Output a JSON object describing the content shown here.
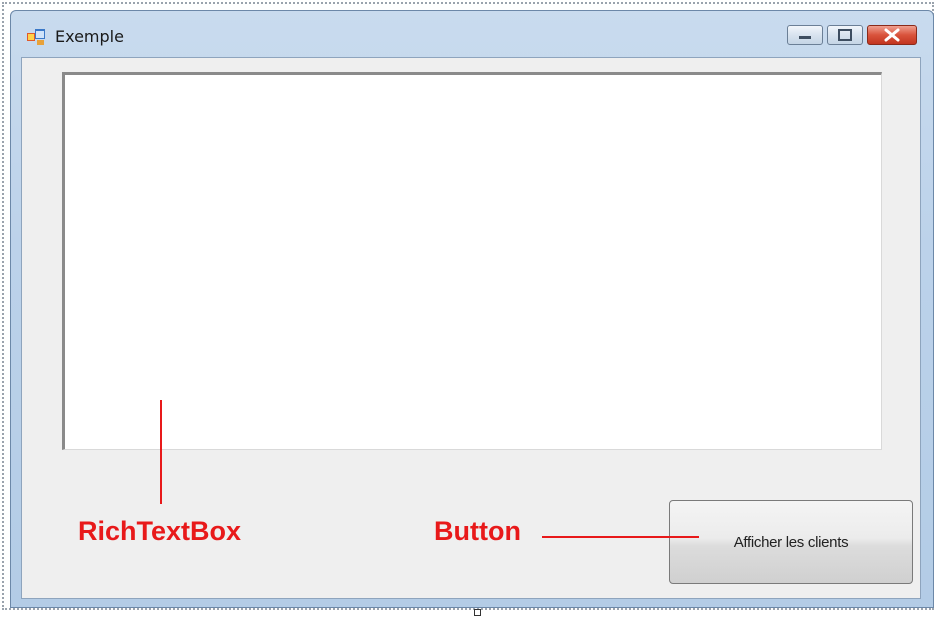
{
  "window": {
    "title": "Exemple",
    "icon": "windows-form-icon",
    "controls": {
      "minimize_icon": "minimize-icon",
      "maximize_icon": "maximize-icon",
      "close_icon": "close-icon"
    }
  },
  "form": {
    "richtextbox": {
      "value": "",
      "background": "#ffffff"
    },
    "button": {
      "label": "Afficher les clients"
    }
  },
  "annotations": {
    "richtextbox_label": "RichTextBox",
    "button_label": "Button",
    "color": "#e8191a"
  }
}
